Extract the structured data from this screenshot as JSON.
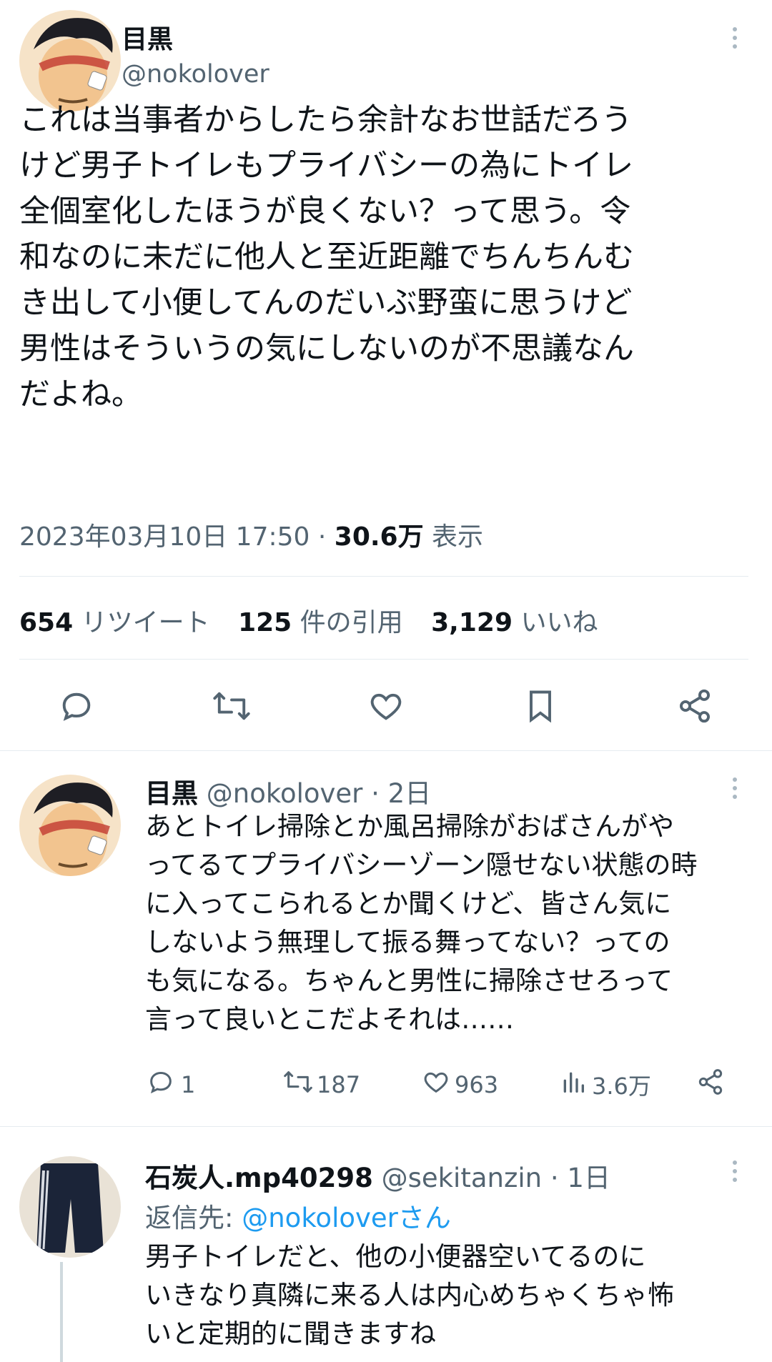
{
  "main_tweet": {
    "display_name": "目黒",
    "handle": "@nokolover",
    "text_lines": [
      "これは当事者からしたら余計なお世話だろう",
      "けど男子トイレもプライバシーの為にトイレ",
      "全個室化したほうが良くない？って思う。令",
      "和なのに未だに他人と至近距離でちんちんむ",
      "き出して小便してんのだいぶ野蛮に思うけど",
      "男性はそういうの気にしないのが不思議なん",
      "だよね。"
    ],
    "timestamp": "2023年03月10日 17:50 · ",
    "views_count": "30.6万",
    "views_label": " 表示",
    "stats": {
      "retweets_count": "654",
      "retweets_label": " リツイート",
      "quotes_count": "125",
      "quotes_label": " 件の引用",
      "likes_count": "3,129",
      "likes_label": " いいね"
    },
    "actions": [
      "reply-icon",
      "retweet-icon",
      "like-icon",
      "bookmark-icon",
      "share-icon"
    ]
  },
  "reply1": {
    "display_name": "目黒",
    "handle_time": " @nokolover · 2日",
    "text_lines": [
      "あとトイレ掃除とか風呂掃除がおばさんがや",
      "ってるてプライバシーゾーン隠せない状態の時",
      "に入ってこられるとか聞くけど、皆さん気に",
      "しないよう無理して振る舞ってない？っての",
      "も気になる。ちゃんと男性に掃除させろって",
      "言って良いとこだよそれは……"
    ],
    "reply_count": "1",
    "retweet_count": "187",
    "like_count": "963",
    "view_count": "3.6万"
  },
  "reply2": {
    "display_name": "石炭人.mp40298",
    "handle_time": " @sekitanzin · 1日",
    "reply_to_prefix": "返信先: ",
    "reply_to_handle": "@nokoloverさん",
    "text_lines": [
      "男子トイレだと、他の小便器空いてるのに",
      "いきなり真隣に来る人は内心めちゃくちゃ怖",
      "いと定期的に聞きますね"
    ]
  },
  "colors": {
    "text": "#0f1419",
    "secondary": "#536471",
    "link": "#1d9bf0",
    "divider": "#e6ecf0"
  }
}
